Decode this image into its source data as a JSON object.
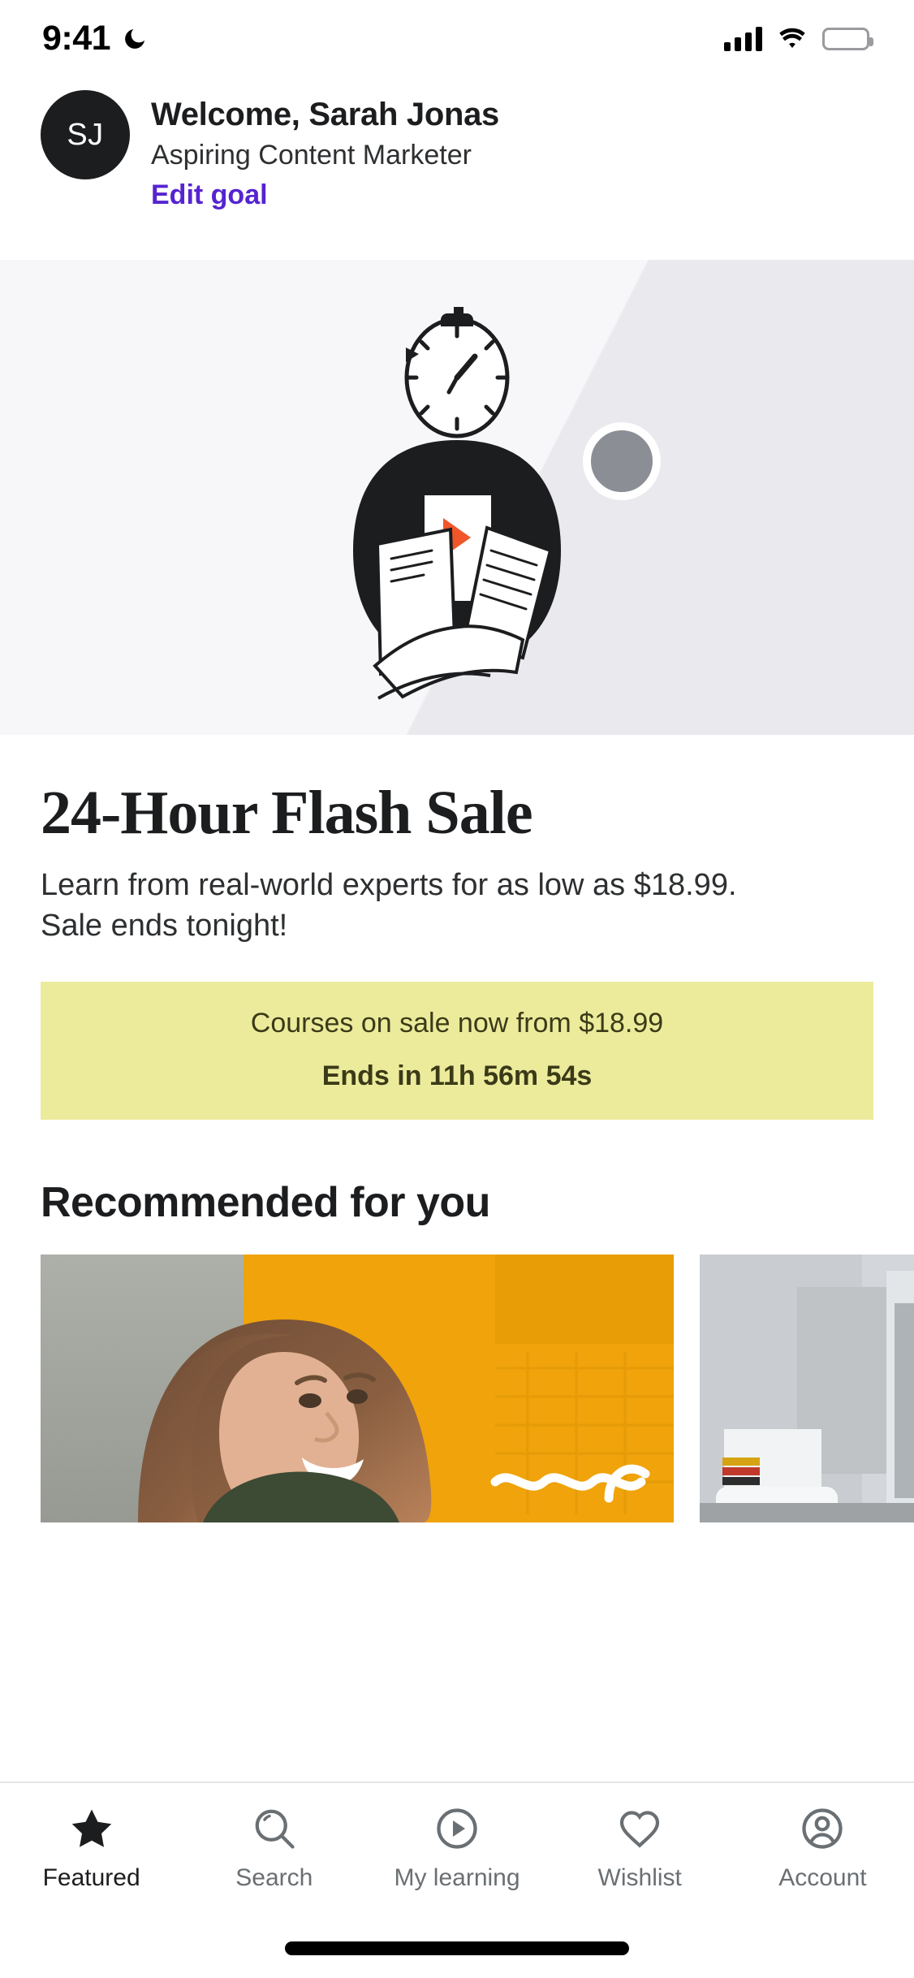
{
  "status_bar": {
    "time": "9:41",
    "dnd_icon": "moon-icon",
    "cellular_icon": "signal-bars-icon",
    "wifi_icon": "wifi-icon",
    "battery_icon": "battery-full-icon"
  },
  "profile": {
    "avatar_initials": "SJ",
    "welcome_title": "Welcome, Sarah Jonas",
    "goal_subtitle": "Aspiring Content Marketer",
    "edit_goal_label": "Edit goal",
    "edit_goal_color": "#5624d0"
  },
  "hero": {
    "illustration_name": "stopwatch-person-reading-illustration",
    "background_top": "#f7f7fa",
    "background_bottom": "#e9e9ee",
    "accent_color": "#f0562a"
  },
  "sale": {
    "title": "24-Hour Flash Sale",
    "description": "Learn from real-world experts for as low as $18.99. Sale ends tonight!",
    "banner": {
      "background_color": "#eceb9c",
      "text_color": "#3b3a18",
      "line1": "Courses on sale now from $18.99",
      "line2": "Ends in 11h 56m 54s"
    }
  },
  "recommended": {
    "heading": "Recommended for you",
    "cards": [
      {
        "thumbnail_name": "smiling-woman-orange-wall-thumbnail"
      },
      {
        "thumbnail_name": "office-interior-blurred-thumbnail"
      }
    ]
  },
  "tabbar": {
    "items": [
      {
        "label": "Featured",
        "icon": "star-filled-icon",
        "active": true
      },
      {
        "label": "Search",
        "icon": "search-icon",
        "active": false
      },
      {
        "label": "My learning",
        "icon": "play-circle-icon",
        "active": false
      },
      {
        "label": "Wishlist",
        "icon": "heart-icon",
        "active": false
      },
      {
        "label": "Account",
        "icon": "user-circle-icon",
        "active": false
      }
    ]
  }
}
